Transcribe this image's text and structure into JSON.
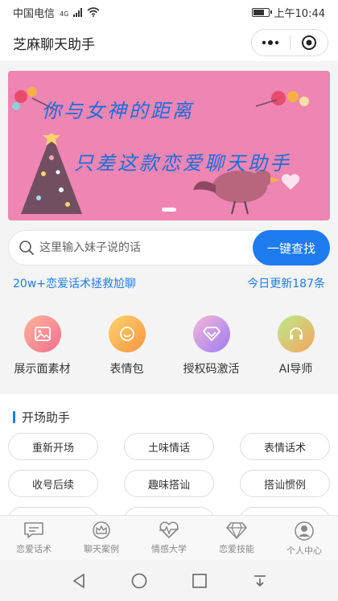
{
  "status_bar": {
    "carrier": "中国电信",
    "network": "4G",
    "time": "上午10:44",
    "battery_level": 0.8
  },
  "title_bar": {
    "title": "芝麻聊天助手",
    "menu_icon": "more-dots-icon",
    "close_icon": "target-close-icon"
  },
  "banner": {
    "line1": "你与女神的距离",
    "line2": "只差这款恋爱聊天助手",
    "background": "#ee85b3",
    "text_color": "#1b6fd8"
  },
  "search": {
    "placeholder": "这里输入妹子说的话",
    "value": "",
    "button_label": "一键查找"
  },
  "info": {
    "left": "20w+恋爱话术拯救尬聊",
    "right": "今日更新187条"
  },
  "features": [
    {
      "label": "展示面素材",
      "icon": "image-icon",
      "color_from": "#ffb39a",
      "color_to": "#f26f8e"
    },
    {
      "label": "表情包",
      "icon": "smile-icon",
      "color_from": "#ffd36e",
      "color_to": "#f79540"
    },
    {
      "label": "授权码激活",
      "icon": "diamond-icon",
      "color_from": "#f7b7d8",
      "color_to": "#9a7cf2"
    },
    {
      "label": "AI导师",
      "icon": "headset-icon",
      "color_from": "#b8ec8a",
      "color_to": "#f7a35c"
    }
  ],
  "section": {
    "title": "开场助手",
    "chips": [
      "重新开场",
      "土味情话",
      "表情话术",
      "收号后续",
      "趣味搭讪",
      "搭讪惯例"
    ]
  },
  "tabs": [
    {
      "label": "恋爱话术",
      "icon": "chat-icon"
    },
    {
      "label": "聊天案例",
      "icon": "crown-icon"
    },
    {
      "label": "情感大学",
      "icon": "heartbeat-icon"
    },
    {
      "label": "恋爱技能",
      "icon": "diamond-icon"
    },
    {
      "label": "个人中心",
      "icon": "user-icon"
    }
  ],
  "accent": "#1e7bf0"
}
